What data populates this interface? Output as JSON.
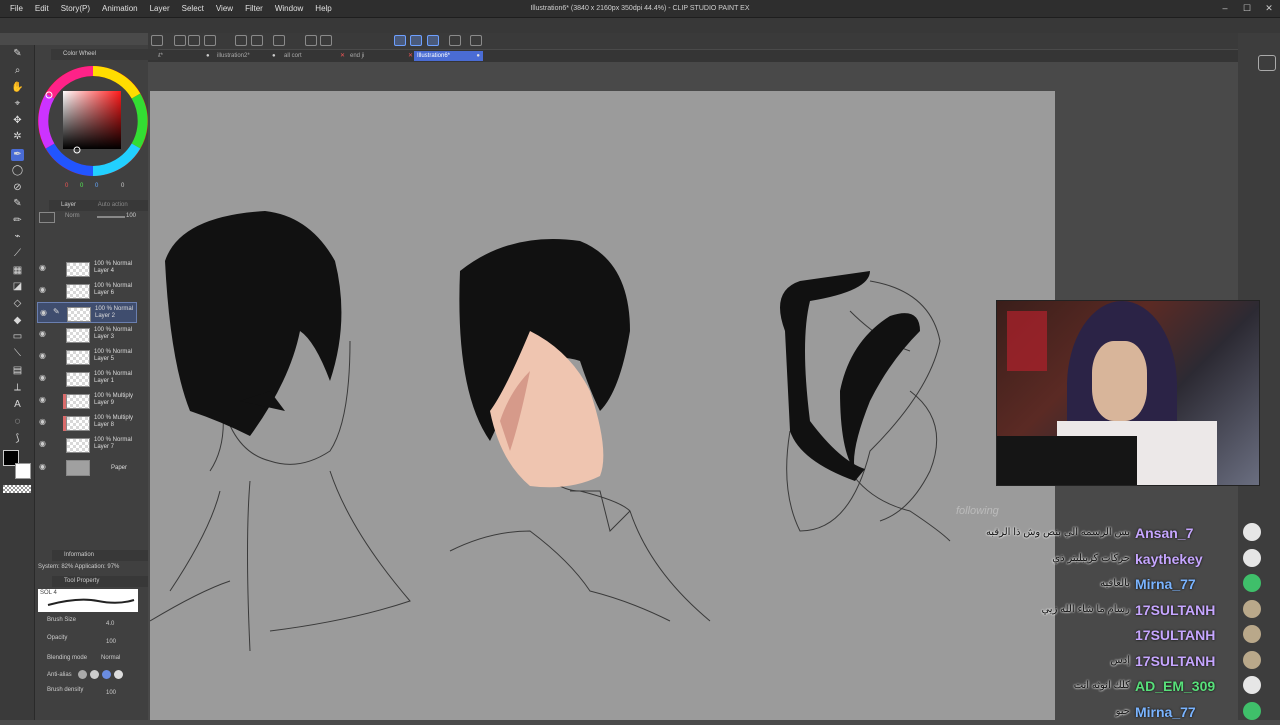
{
  "menu": [
    "File",
    "Edit",
    "Story(P)",
    "Animation",
    "Layer",
    "Select",
    "View",
    "Filter",
    "Window",
    "Help"
  ],
  "window_title": "Illustration6* (3840 x 2160px 350dpi 44.4%) - CLIP STUDIO PAINT EX",
  "window_controls": [
    "–",
    "☐",
    "✕"
  ],
  "tabs": [
    {
      "label": "test*",
      "active": false
    },
    {
      "label": "illustration2*",
      "active": false
    },
    {
      "label": "all cort",
      "active": false
    },
    {
      "label": "end ji",
      "active": false
    },
    {
      "label": "Illustration6*",
      "active": true
    }
  ],
  "color_panel": {
    "title": "Color Wheel",
    "r": "0",
    "g": "0",
    "b": "0",
    "hsv_h": "0",
    "hsv_s": "0",
    "hsv_v": "0"
  },
  "layer_panel": {
    "title": "Layer",
    "title2": "Auto action",
    "blend": "Norm",
    "opacity": "100",
    "layers": [
      {
        "pct": "100 % Normal",
        "name": "Layer 4",
        "selected": false,
        "mark": false
      },
      {
        "pct": "100 % Normal",
        "name": "Layer 6",
        "selected": false,
        "mark": false
      },
      {
        "pct": "100 % Normal",
        "name": "Layer 2",
        "selected": true,
        "mark": false
      },
      {
        "pct": "100 % Normal",
        "name": "Layer 3",
        "selected": false,
        "mark": false
      },
      {
        "pct": "100 % Normal",
        "name": "Layer 5",
        "selected": false,
        "mark": false
      },
      {
        "pct": "100 % Normal",
        "name": "Layer 1",
        "selected": false,
        "mark": false
      },
      {
        "pct": "100 % Multiply",
        "name": "Layer 9",
        "selected": false,
        "mark": true
      },
      {
        "pct": "100 % Multiply",
        "name": "Layer 8",
        "selected": false,
        "mark": true
      },
      {
        "pct": "100 % Normal",
        "name": "Layer 7",
        "selected": false,
        "mark": false
      }
    ],
    "paper": "Paper"
  },
  "info_panel": {
    "title": "Information",
    "system": "System: 82%  Application: 97%"
  },
  "tool_property": {
    "title": "Tool Property",
    "brush_name": "SOL 4",
    "brush_size_label": "Brush Size",
    "brush_size_value": "4.0",
    "opacity_label": "Opacity",
    "opacity_value": "100",
    "blending_label": "Blending mode",
    "blending_value": "Normal",
    "antialias_label": "Anti-alias",
    "density_label": "Brush density",
    "density_value": "100"
  },
  "stream": {
    "following_label": "following",
    "messages": [
      {
        "user": "Ansan_7",
        "text": "بس الرسمه الي بنص وش ذا الرقبه",
        "color": "#c6a6ff",
        "avatar": "#e6e6e6"
      },
      {
        "user": "kaythekey",
        "text": "حركات كريبليتر ذي",
        "color": "#c6a6ff",
        "avatar": "#e6e6e6"
      },
      {
        "user": "Mirna_77",
        "text": "بالعافيه",
        "color": "#7ab4ff",
        "avatar": "#3fbf6a"
      },
      {
        "user": "17SULTANH",
        "text": "رسام ما شاء الله زيي",
        "color": "#c6a6ff",
        "avatar": "#b9a88a"
      },
      {
        "user": "17SULTANH",
        "text": "",
        "color": "#c6a6ff",
        "avatar": "#b9a88a"
      },
      {
        "user": "17SULTANH",
        "text": "إدس",
        "color": "#c6a6ff",
        "avatar": "#b9a88a"
      },
      {
        "user": "AD_EM_309",
        "text": "كلك انوثه انت",
        "color": "#58e07a",
        "avatar": "#e6e6e6"
      },
      {
        "user": "Mirna_77",
        "text": "حبو",
        "color": "#7ab4ff",
        "avatar": "#3fbf6a"
      }
    ]
  }
}
